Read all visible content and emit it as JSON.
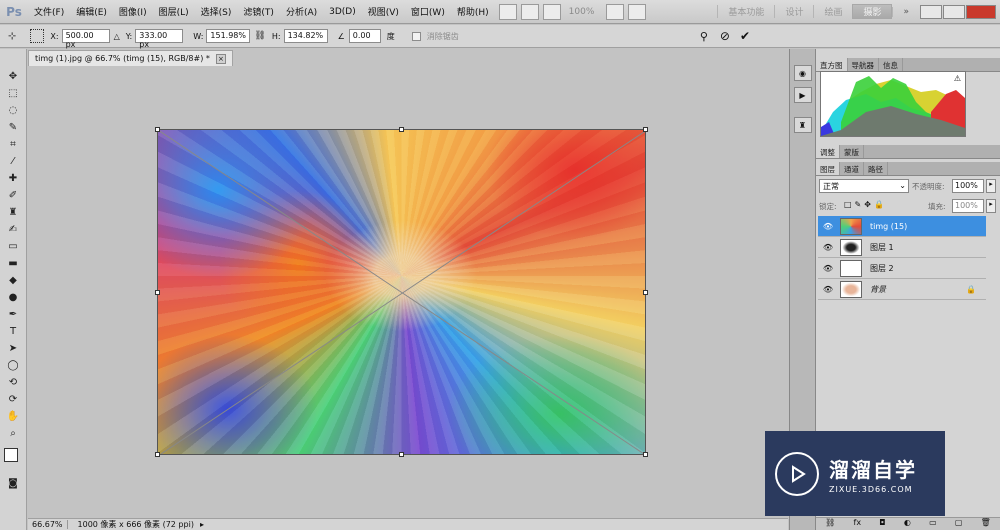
{
  "app": {
    "logo_text": "Ps"
  },
  "menubar": {
    "items": [
      "文件(F)",
      "编辑(E)",
      "图像(I)",
      "图层(L)",
      "选择(S)",
      "滤镜(T)",
      "分析(A)",
      "3D(D)",
      "视图(V)",
      "窗口(W)",
      "帮助(H)"
    ],
    "zoom_label": "100%",
    "workspaces": [
      "基本功能",
      "设计",
      "绘画",
      "摄影"
    ],
    "active_workspace": "摄影",
    "more_label": "»"
  },
  "options_bar": {
    "x_label": "X:",
    "x_value": "500.00 px",
    "y_label": "Y:",
    "y_value": "333.00 px",
    "w_label": "W:",
    "w_value": "151.98%",
    "h_label": "H:",
    "h_value": "134.82%",
    "angle_value": "0.00",
    "angle_unit": "度",
    "checkbox_label": "消除锯齿"
  },
  "document": {
    "tab_title": "timg (1).jpg @ 66.7% (timg (15), RGB/8#) *",
    "close_label": "×"
  },
  "panels": {
    "top_tabs": [
      "直方图",
      "导航器",
      "信息"
    ],
    "adjust_tabs": [
      "调整",
      "蒙版"
    ],
    "layer_tabs": [
      "图层",
      "通道",
      "路径"
    ],
    "blend_mode": "正常",
    "opacity_label": "不透明度:",
    "opacity_value": "100%",
    "lock_label": "锁定:",
    "fill_label": "填充:",
    "fill_value": "100%",
    "layers": [
      {
        "name": "timg (15)",
        "selected": true
      },
      {
        "name": "图层 1",
        "selected": false
      },
      {
        "name": "图层 2",
        "selected": false
      },
      {
        "name": "背景",
        "selected": false
      }
    ]
  },
  "status": {
    "zoom": "66.67%",
    "doc_info": "1000 像素 x 666 像素 (72 ppi)"
  },
  "watermark": {
    "title": "溜溜自学",
    "subtitle": "ZIXUE.3D66.COM"
  },
  "colors": {
    "selection": "#3d8fe0",
    "watermark_bg": "#2b3a5e",
    "close_button": "#c9392c"
  }
}
